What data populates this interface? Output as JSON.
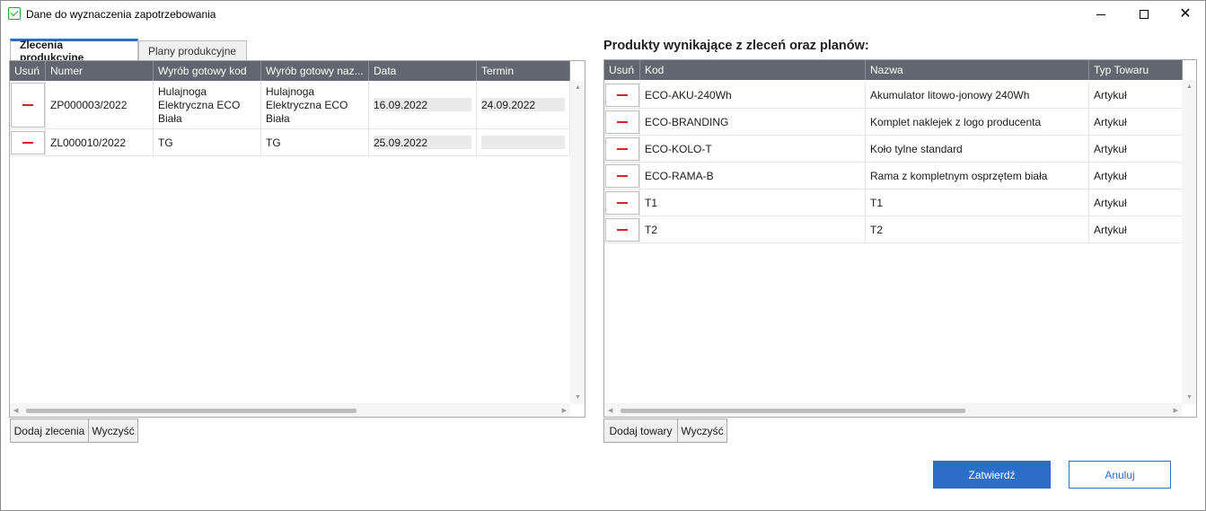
{
  "window": {
    "title": "Dane do wyznaczenia zapotrzebowania",
    "icon": "basket-icon",
    "controls": {
      "minimize": "minimize-icon",
      "maximize": "maximize-icon",
      "close": "close-icon",
      "close_glyph": "✕"
    }
  },
  "left": {
    "tabs": [
      {
        "label": "Zlecenia produkcyjne",
        "active": true
      },
      {
        "label": "Plany produkcyjne",
        "active": false
      }
    ],
    "columns": [
      "Usuń",
      "Numer",
      "Wyrób gotowy kod",
      "Wyrób gotowy naz...",
      "Data",
      "Termin"
    ],
    "rows": [
      {
        "numer": "ZP000003/2022",
        "kod": "Hulajnoga Elektryczna ECO Biała",
        "nazwa": "Hulajnoga Elektryczna ECO Biała",
        "data": "16.09.2022",
        "termin": "24.09.2022"
      },
      {
        "numer": "ZL000010/2022",
        "kod": "TG",
        "nazwa": "TG",
        "data": "25.09.2022",
        "termin": ""
      }
    ],
    "buttons": {
      "add": "Dodaj zlecenia",
      "clear": "Wyczyść"
    }
  },
  "right": {
    "title": "Produkty wynikające z zleceń oraz planów:",
    "columns": [
      "Usuń",
      "Kod",
      "Nazwa",
      "Typ Towaru"
    ],
    "rows": [
      {
        "kod": "ECO-AKU-240Wh",
        "nazwa": "Akumulator litowo-jonowy 240Wh",
        "typ": "Artykuł"
      },
      {
        "kod": "ECO-BRANDING",
        "nazwa": "Komplet naklejek z logo producenta",
        "typ": "Artykuł"
      },
      {
        "kod": "ECO-KOLO-T",
        "nazwa": "Koło tylne standard",
        "typ": "Artykuł"
      },
      {
        "kod": "ECO-RAMA-B",
        "nazwa": "Rama z kompletnym osprzętem biała",
        "typ": "Artykuł"
      },
      {
        "kod": "T1",
        "nazwa": "T1",
        "typ": "Artykuł"
      },
      {
        "kod": "T2",
        "nazwa": "T2",
        "typ": "Artykuł"
      }
    ],
    "buttons": {
      "add": "Dodaj towary",
      "clear": "Wyczyść"
    }
  },
  "footer": {
    "confirm": "Zatwierdź",
    "cancel": "Anuluj"
  },
  "colors": {
    "accent": "#2b6ec9",
    "header_bg": "#636670",
    "delete": "#d8232a"
  }
}
